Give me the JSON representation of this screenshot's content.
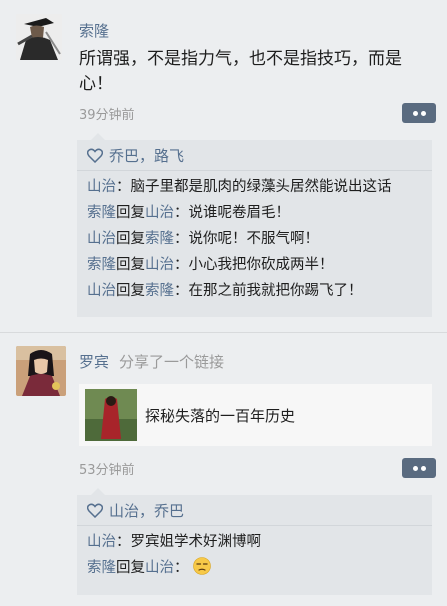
{
  "posts": [
    {
      "author": "索隆",
      "text_lines": [
        "所谓强，不是指力气，也不是指技巧，而是",
        "心！"
      ],
      "time": "39分钟前",
      "more_icon": "ellipsis-icon",
      "likes": "乔巴，路飞",
      "comments": [
        {
          "name": "山治",
          "reply_word": "",
          "reply_to": "",
          "text": "：脑子里都是肌肉的绿藻头居然能说出这话"
        },
        {
          "name": "索隆",
          "reply_word": "回复",
          "reply_to": "山治",
          "text": "：说谁呢卷眉毛！"
        },
        {
          "name": "山治",
          "reply_word": "回复",
          "reply_to": "索隆",
          "text": "：说你呢！不服气啊！"
        },
        {
          "name": "索隆",
          "reply_word": "回复",
          "reply_to": "山治",
          "text": "：小心我把你砍成两半！"
        },
        {
          "name": "山治",
          "reply_word": "回复",
          "reply_to": "索隆",
          "text": "：在那之前我就把你踢飞了！"
        }
      ]
    },
    {
      "author": "罗宾",
      "action": "分享了一个链接",
      "link_title": "探秘失落的一百年历史",
      "time": "53分钟前",
      "more_icon": "ellipsis-icon",
      "likes": "山治，乔巴",
      "comments": [
        {
          "name": "山治",
          "reply_word": "",
          "reply_to": "",
          "text": "：罗宾姐学术好渊博啊"
        },
        {
          "name": "索隆",
          "reply_word": "回复",
          "reply_to": "山治",
          "text": "：",
          "emoji": "unamused-face-emoji"
        }
      ]
    }
  ],
  "colors": {
    "background": "#eceef0",
    "name_blue": "#56708f",
    "like_box": "#e2e5e8",
    "more_button": "#5a6b80"
  }
}
